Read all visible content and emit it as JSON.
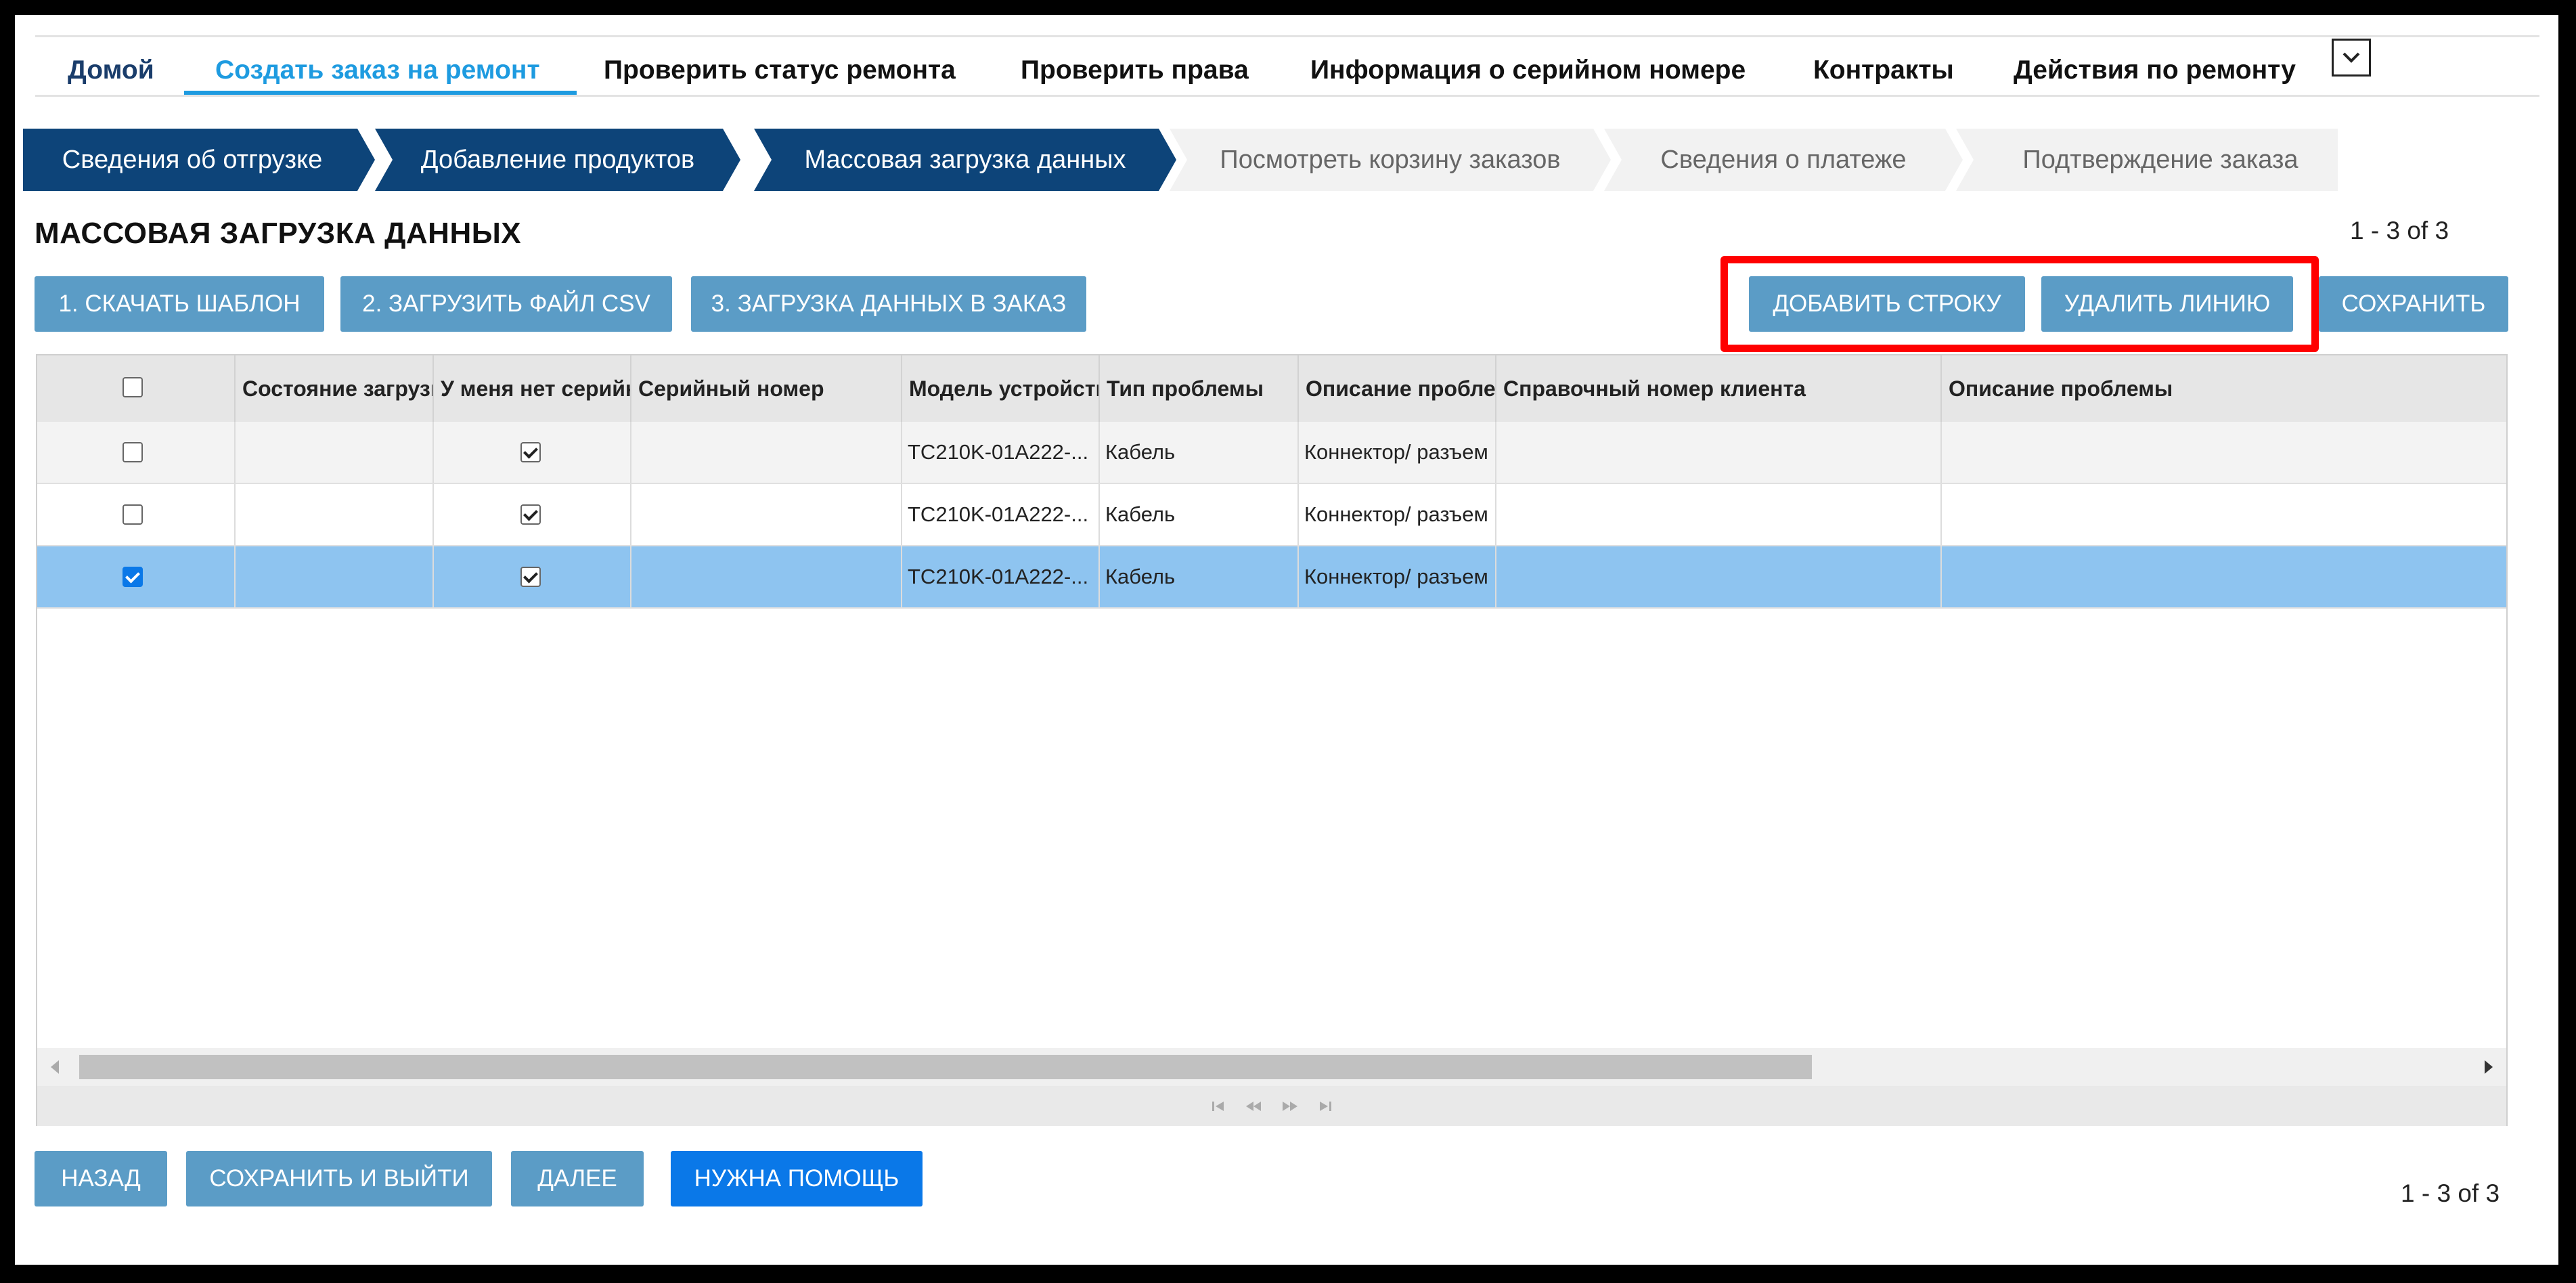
{
  "nav": {
    "items": [
      {
        "label": "Домой",
        "state": "home"
      },
      {
        "label": "Создать заказ на ремонт",
        "state": "active"
      },
      {
        "label": "Проверить статус ремонта",
        "state": ""
      },
      {
        "label": "Проверить права",
        "state": ""
      },
      {
        "label": "Информация о серийном номере",
        "state": ""
      },
      {
        "label": "Контракты",
        "state": ""
      },
      {
        "label": "Действия по ремонту",
        "state": ""
      }
    ],
    "more_icon": "chevron-down-icon"
  },
  "steps": [
    {
      "label": "Сведения об отгрузке",
      "done": true
    },
    {
      "label": "Добавление продуктов",
      "done": true
    },
    {
      "label": "Массовая загрузка данных",
      "done": true
    },
    {
      "label": "Посмотреть корзину заказов",
      "done": false
    },
    {
      "label": "Сведения о платеже",
      "done": false
    },
    {
      "label": "Подтверждение заказа",
      "done": false
    }
  ],
  "section": {
    "title": "МАССОВАЯ ЗАГРУЗКА ДАННЫХ",
    "pager": "1 - 3 of 3"
  },
  "toolbar": {
    "download_template": "1. СКАЧАТЬ ШАБЛОН",
    "upload_csv": "2. ЗАГРУЗИТЬ ФАЙЛ CSV",
    "load_to_order": "3. ЗАГРУЗКА ДАННЫХ В ЗАКАЗ",
    "add_row": "ДОБАВИТЬ СТРОКУ",
    "delete_line": "УДАЛИТЬ ЛИНИЮ",
    "save": "СОХРАНИТЬ"
  },
  "table": {
    "columns": [
      "Состояние загрузки",
      "У меня нет серийного номера",
      "Серийный номер",
      "Модель устройства",
      "Тип проблемы",
      "Описание проблемы",
      "Справочный номер клиента",
      "Описание проблемы"
    ],
    "rows": [
      {
        "selected": false,
        "status": "",
        "no_serial": true,
        "serial": "",
        "model": "TC210K-01A222-...",
        "problem_type": "Кабель",
        "problem_desc": "Коннектор/ разъем",
        "ref": "",
        "description": ""
      },
      {
        "selected": false,
        "status": "",
        "no_serial": true,
        "serial": "",
        "model": "TC210K-01A222-...",
        "problem_type": "Кабель",
        "problem_desc": "Коннектор/ разъем",
        "ref": "",
        "description": ""
      },
      {
        "selected": true,
        "status": "",
        "no_serial": true,
        "serial": "",
        "model": "TC210K-01A222-...",
        "problem_type": "Кабель",
        "problem_desc": "Коннектор/ разъем",
        "ref": "",
        "description": ""
      }
    ]
  },
  "footer": {
    "back": "НАЗАД",
    "save_exit": "СОХРАНИТЬ И ВЫЙТИ",
    "next": "ДАЛЕЕ",
    "help": "НУЖНА ПОМОЩЬ",
    "pager": "1 - 3 of 3"
  },
  "colors": {
    "accent": "#1e9be0",
    "step_done": "#0d4479",
    "button": "#5b9cc6",
    "button_primary": "#0a78e8",
    "selected_row": "#8ec4f0",
    "highlight": "#ff0000"
  }
}
